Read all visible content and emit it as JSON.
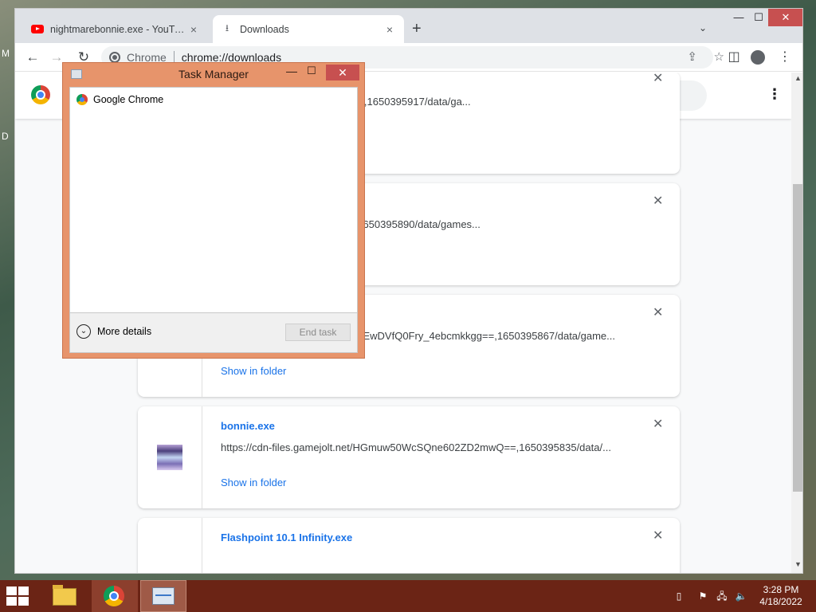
{
  "desktop": {
    "glyph_m": "M",
    "glyph_d": "D"
  },
  "tabs": [
    {
      "title": "nightmarebonnie.exe - YouTube",
      "close": "×"
    },
    {
      "title": "Downloads",
      "close": "×"
    }
  ],
  "tabstrip": {
    "new_tab": "+",
    "search": "⌄"
  },
  "window_controls": {
    "minimize": "—",
    "maximize": "☐",
    "close": "✕"
  },
  "toolbar": {
    "back": "←",
    "forward": "→",
    "reload": "↻",
    "omnibox_site": "Chrome",
    "omnibox_url": "chrome://downloads",
    "share": "⇪",
    "bookmark": "☆",
    "side_panel": "◫",
    "menu": "⋮"
  },
  "downloads_page": {
    "menu": "⋮",
    "items": [
      {
        "name": "",
        "url": "6d1srpZON_JCgq1PPZMew==,1650395917/data/ga...",
        "show_in_folder": "",
        "close": "✕"
      },
      {
        "name": "",
        "url": "4FsEbrTpjkRH-3zhGbJZQ==,1650395890/data/games...",
        "show_in_folder": "",
        "close": "✕"
      },
      {
        "name": "",
        "url": "https://cdn-files.gamejolt.net/RtEwDVfQ0Fry_4ebcmkkgg==,1650395867/data/game...",
        "show_in_folder": "Show in folder",
        "close": "✕"
      },
      {
        "name": "bonnie.exe",
        "url": "https://cdn-files.gamejolt.net/HGmuw50WcSQne602ZD2mwQ==,1650395835/data/...",
        "show_in_folder": "Show in folder",
        "close": "✕"
      },
      {
        "name": "Flashpoint 10.1 Infinity.exe",
        "url": "",
        "show_in_folder": "",
        "close": "✕"
      }
    ]
  },
  "scrollbar": {
    "up": "▲",
    "down": "▼"
  },
  "task_manager": {
    "title": "Task Manager",
    "minimize": "—",
    "maximize": "☐",
    "close": "✕",
    "processes": [
      "Google Chrome"
    ],
    "more_details": "More details",
    "more_details_icon": "⌄",
    "end_task": "End task"
  },
  "taskbar": {
    "tray_flag": "⚑",
    "tray_network": "🖧",
    "tray_volume": "🔈",
    "tray_notes": "▯",
    "time": "3:28 PM",
    "date": "4/18/2022"
  }
}
